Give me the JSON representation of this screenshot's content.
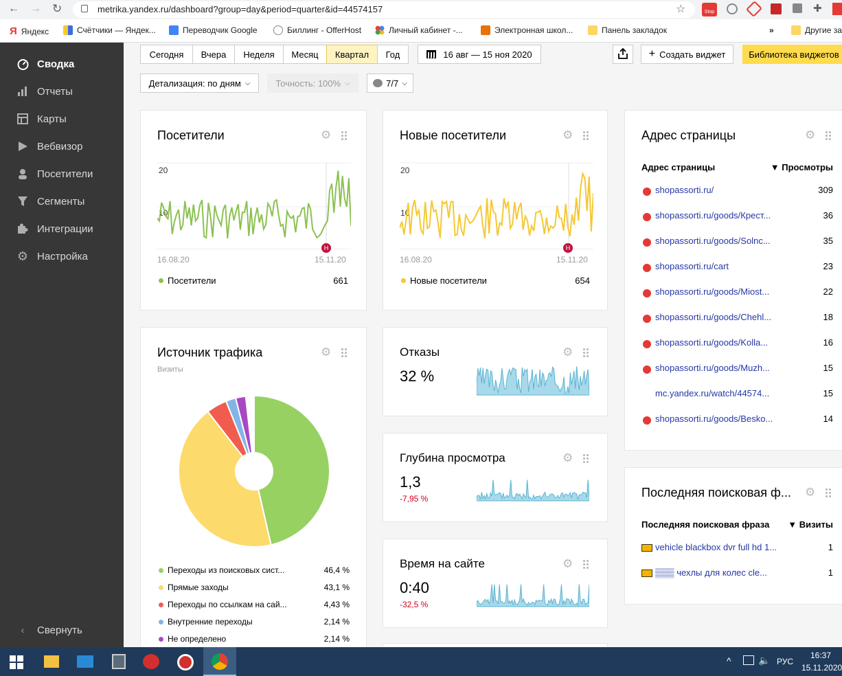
{
  "browser": {
    "url": "metrika.yandex.ru/dashboard?group=day&period=quarter&id=44574157",
    "ext_badge": "Stop"
  },
  "bookmarks": [
    "Яндекс",
    "Счётчики — Яндек...",
    "Переводчик Google",
    "Биллинг - OfferHost",
    "Личный кабинет -...",
    "Электронная школ...",
    "Панель закладок",
    "»",
    "Другие закл"
  ],
  "sidebar": {
    "items": [
      {
        "label": "Сводка",
        "icon": "speedometer-icon"
      },
      {
        "label": "Отчеты",
        "icon": "bar-chart-icon"
      },
      {
        "label": "Карты",
        "icon": "map-icon"
      },
      {
        "label": "Вебвизор",
        "icon": "play-icon"
      },
      {
        "label": "Посетители",
        "icon": "person-icon"
      },
      {
        "label": "Сегменты",
        "icon": "funnel-icon"
      },
      {
        "label": "Интеграции",
        "icon": "puzzle-icon"
      },
      {
        "label": "Настройка",
        "icon": "gear-icon"
      }
    ],
    "collapse": "Свернуть"
  },
  "toolbar": {
    "periods": [
      "Сегодня",
      "Вчера",
      "Неделя",
      "Месяц",
      "Квартал",
      "Год"
    ],
    "active_period": "Квартал",
    "date_range": "16 авг — 15 ноя 2020",
    "create_widget": "Создать виджет",
    "library": "Библиотека виджетов",
    "detail": "Детализация: по дням",
    "accuracy": "Точность: 100%",
    "comments": "7/7"
  },
  "visitors": {
    "title": "Посетители",
    "y_ticks": [
      "20",
      "10"
    ],
    "x_start": "16.08.20",
    "x_end": "15.11.20",
    "marker": "Н",
    "legend": "Посетители",
    "total": "661",
    "color": "#8cc152"
  },
  "new_visitors": {
    "title": "Новые посетители",
    "y_ticks": [
      "20",
      "10"
    ],
    "x_start": "16.08.20",
    "x_end": "15.11.20",
    "marker": "Н",
    "legend": "Новые посетители",
    "total": "654",
    "color": "#f5c834"
  },
  "traffic": {
    "title": "Источник трафика",
    "subtitle": "Визиты",
    "legend": [
      {
        "label": "Переходы из поисковых сист...",
        "value": "46,4 %",
        "color": "#96d162"
      },
      {
        "label": "Прямые заходы",
        "value": "43,1 %",
        "color": "#fdda6c"
      },
      {
        "label": "Переходы по ссылкам на сай...",
        "value": "4,43 %",
        "color": "#f05d4e"
      },
      {
        "label": "Внутренние переходы",
        "value": "2,14 %",
        "color": "#83b4e6"
      },
      {
        "label": "Не определено",
        "value": "2,14 %",
        "color": "#a849c4"
      }
    ]
  },
  "bounce": {
    "title": "Отказы",
    "value": "32 %",
    "delta": ""
  },
  "depth": {
    "title": "Глубина просмотра",
    "value": "1,3",
    "delta": "-7,95 %"
  },
  "time": {
    "title": "Время на сайте",
    "value": "0:40",
    "delta": "-32,5 %"
  },
  "pages": {
    "title": "Адрес страницы",
    "col1": "Адрес страницы",
    "col2": "▼ Просмотры",
    "rows": [
      {
        "url": "shopassorti.ru/",
        "views": "309",
        "icon": true
      },
      {
        "url": "shopassorti.ru/goods/Крест...",
        "views": "36",
        "icon": true
      },
      {
        "url": "shopassorti.ru/goods/Solnc...",
        "views": "35",
        "icon": true
      },
      {
        "url": "shopassorti.ru/cart",
        "views": "23",
        "icon": true
      },
      {
        "url": "shopassorti.ru/goods/Miost...",
        "views": "22",
        "icon": true
      },
      {
        "url": "shopassorti.ru/goods/Chehl...",
        "views": "18",
        "icon": true
      },
      {
        "url": "shopassorti.ru/goods/Kolla...",
        "views": "16",
        "icon": true
      },
      {
        "url": "shopassorti.ru/goods/Muzh...",
        "views": "15",
        "icon": true
      },
      {
        "url": "mc.yandex.ru/watch/44574...",
        "views": "15",
        "icon": false
      },
      {
        "url": "shopassorti.ru/goods/Besko...",
        "views": "14",
        "icon": true
      }
    ]
  },
  "search": {
    "title": "Последняя поисковая ф...",
    "col1": "Последняя поисковая фраза",
    "col2": "▼ Визиты",
    "rows": [
      {
        "phrase": "vehicle blackbox dvr full hd 1...",
        "visits": "1"
      },
      {
        "phrase": "▒▒▒ чехлы для колес cle...",
        "visits": "1"
      }
    ]
  },
  "taskbar": {
    "lang": "РУС",
    "time": "16:37",
    "date": "15.11.2020"
  }
}
